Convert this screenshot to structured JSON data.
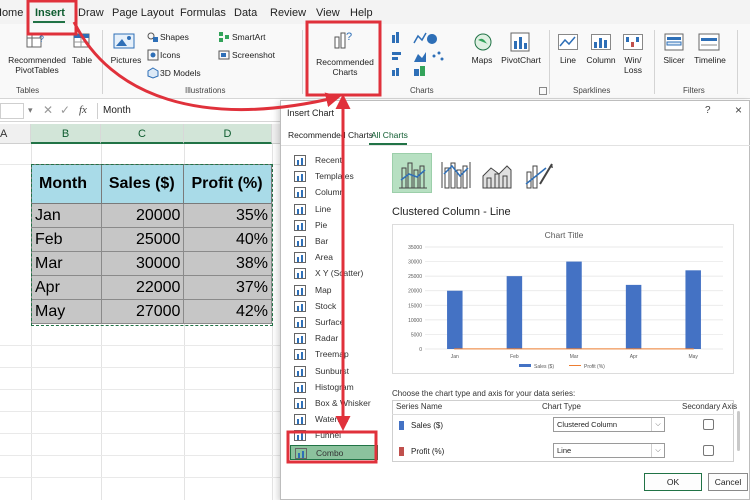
{
  "ribbon": {
    "tabs": [
      "Home",
      "Insert",
      "Draw",
      "Page Layout",
      "Formulas",
      "Data",
      "Review",
      "View",
      "Help"
    ],
    "active_tab": "Insert",
    "tables": {
      "recommended_pivot": "Recommended PivotTables",
      "table": "Table",
      "label": "Tables"
    },
    "illustrations": {
      "pictures": "Pictures",
      "shapes": "Shapes",
      "icons": "Icons",
      "models": "3D Models",
      "smartart": "SmartArt",
      "screenshot": "Screenshot",
      "label": "Illustrations"
    },
    "charts": {
      "recommended": "Recommended Charts",
      "maps": "Maps",
      "pivotchart": "PivotChart",
      "label": "Charts"
    },
    "sparklines": {
      "line": "Line",
      "column": "Column",
      "winloss": "Win/ Loss",
      "label": "Sparklines"
    },
    "filters": {
      "slicer": "Slicer",
      "timeline": "Timeline",
      "label": "Filters"
    }
  },
  "formula_bar": {
    "name_box": "",
    "fx": "fx",
    "value": "Month"
  },
  "sheet": {
    "columns": [
      "A",
      "B",
      "C",
      "D"
    ],
    "table": {
      "headers": [
        "Month",
        "Sales ($)",
        "Profit (%)"
      ],
      "rows": [
        [
          "Jan",
          "20000",
          "35%"
        ],
        [
          "Feb",
          "25000",
          "40%"
        ],
        [
          "Mar",
          "30000",
          "38%"
        ],
        [
          "Apr",
          "22000",
          "37%"
        ],
        [
          "May",
          "27000",
          "42%"
        ]
      ]
    }
  },
  "dialog": {
    "title": "Insert Chart",
    "help": "?",
    "close": "×",
    "tabs": [
      "Recommended Charts",
      "All Charts"
    ],
    "chart_types": [
      "Recent",
      "Templates",
      "Column",
      "Line",
      "Pie",
      "Bar",
      "Area",
      "X Y (Scatter)",
      "Map",
      "Stock",
      "Surface",
      "Radar",
      "Treemap",
      "Sunburst",
      "Histogram",
      "Box & Whisker",
      "Waterfall",
      "Funnel",
      "Combo"
    ],
    "selected_type": "Combo",
    "combo_name": "Clustered Column - Line",
    "series_instruction": "Choose the chart type and axis for your data series:",
    "series_headers": {
      "name": "Series Name",
      "type": "Chart Type",
      "secondary": "Secondary Axis"
    },
    "series": [
      {
        "name": "Sales ($)",
        "type": "Clustered Column",
        "color": "#4472c4"
      },
      {
        "name": "Profit (%)",
        "type": "Line",
        "color": "#c0504d"
      }
    ],
    "ok": "OK",
    "cancel": "Cancel"
  },
  "chart_data": {
    "type": "bar",
    "title": "Chart Title",
    "categories": [
      "Jan",
      "Feb",
      "Mar",
      "Apr",
      "May"
    ],
    "series": [
      {
        "name": "Sales ($)",
        "type": "bar",
        "values": [
          20000,
          25000,
          30000,
          22000,
          27000
        ],
        "color": "#4472c4"
      },
      {
        "name": "Profit (%)",
        "type": "line",
        "values": [
          35,
          40,
          38,
          37,
          42
        ],
        "color": "#ed7d31"
      }
    ],
    "ylim": [
      0,
      35000
    ],
    "yticks": [
      "35000",
      "30000",
      "25000",
      "20000",
      "15000",
      "10000",
      "5000",
      "0"
    ],
    "legend": "bottom",
    "grid": true
  },
  "colors": {
    "accent": "#217346",
    "highlight": "#e0313b",
    "header_fill": "#a9dbe8",
    "cell_fill": "#c6c6c6"
  }
}
